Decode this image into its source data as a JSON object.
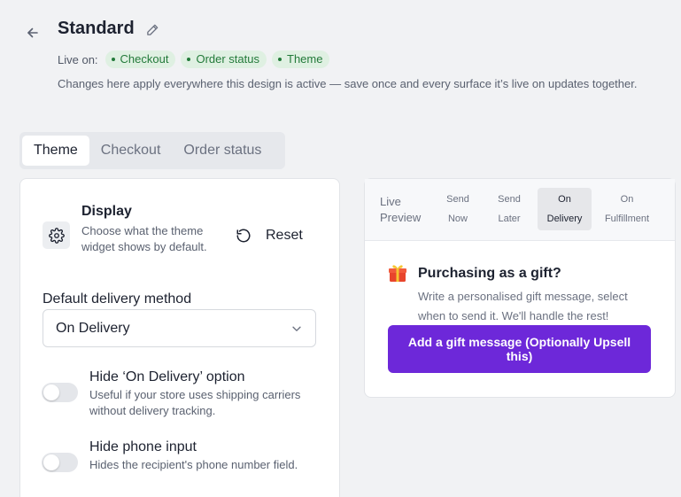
{
  "header": {
    "title": "Standard",
    "live_on_label": "Live on:",
    "live_on_chips": [
      "Checkout",
      "Order status",
      "Theme"
    ],
    "description": "Changes here apply everywhere this design is active — save once and every surface it’s live on updates together."
  },
  "tabs": [
    {
      "label": "Theme",
      "active": true
    },
    {
      "label": "Checkout",
      "active": false
    },
    {
      "label": "Order status",
      "active": false
    }
  ],
  "display": {
    "icon": "gear-icon",
    "title": "Display",
    "description": "Choose what the theme widget shows by default.",
    "reset_label": "Reset"
  },
  "delivery": {
    "label": "Default delivery method",
    "selected": "On Delivery"
  },
  "options": [
    {
      "title": "Hide ‘On Delivery’ option",
      "description": "Useful if your store uses shipping carriers without delivery tracking.",
      "enabled": false
    },
    {
      "title": "Hide phone input",
      "description": "Hides the recipient's phone number field.",
      "enabled": false
    }
  ],
  "preview": {
    "label": "Live Preview",
    "tabs": [
      {
        "line1": "Send",
        "line2": "Now",
        "active": false
      },
      {
        "line1": "Send",
        "line2": "Later",
        "active": false
      },
      {
        "line1": "On",
        "line2": "Delivery",
        "active": true
      },
      {
        "line1": "On",
        "line2": "Fulfillment",
        "active": false
      }
    ],
    "gift_icon": "gift-icon",
    "gift_title": "Purchasing as a gift?",
    "gift_description": "Write a personalised gift message, select when to send it. We'll handle the rest!",
    "gift_button": "Add a gift message (Optionally Upsell this)"
  },
  "colors": {
    "accent": "#6d28d9",
    "chip_bg": "#dff0e2",
    "chip_text": "#237a3a"
  }
}
